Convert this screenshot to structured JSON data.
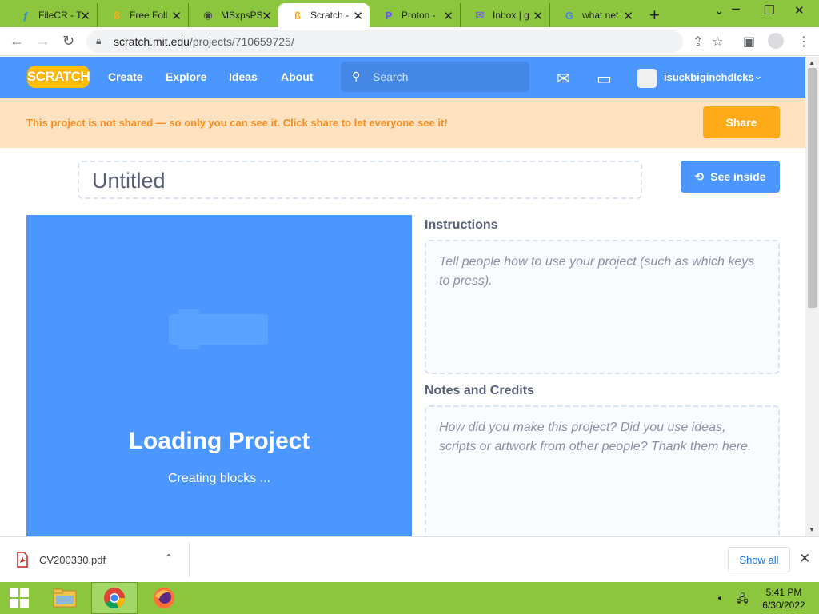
{
  "browser": {
    "tabs": [
      {
        "title": "FileCR - T",
        "icon": "filecr-icon",
        "active": false
      },
      {
        "title": "Free Foll",
        "icon": "scratch-cat-icon",
        "active": false
      },
      {
        "title": "MSxpsPS",
        "icon": "globe-icon",
        "active": false
      },
      {
        "title": "Scratch -",
        "icon": "scratch-cat-icon",
        "active": true
      },
      {
        "title": "Proton -",
        "icon": "proton-icon",
        "active": false
      },
      {
        "title": "Inbox | g",
        "icon": "mail-icon",
        "active": false
      },
      {
        "title": "what net",
        "icon": "google-icon",
        "active": false
      }
    ],
    "address": {
      "host": "scratch.mit.edu",
      "path": "/projects/710659725/"
    }
  },
  "scratch_nav": {
    "logo": "SCRATCH",
    "links": [
      "Create",
      "Explore",
      "Ideas",
      "About"
    ],
    "search_placeholder": "Search",
    "username": "isuckbiginchdlcks"
  },
  "banner": {
    "message": "This project is not shared — so only you can see it. Click share to let everyone see it!",
    "share_label": "Share"
  },
  "project": {
    "title": "Untitled",
    "see_inside_label": "See inside",
    "loading_title": "Loading Project",
    "loading_status": "Creating blocks ..."
  },
  "instructions": {
    "heading": "Instructions",
    "placeholder": "Tell people how to use your project (such as which keys to press)."
  },
  "notes": {
    "heading": "Notes and Credits",
    "placeholder": "How did you make this project? Did you use ideas, scripts or artwork from other people? Thank them here."
  },
  "downloads": {
    "file_name": "CV200330.pdf",
    "show_all_label": "Show all"
  },
  "taskbar": {
    "time": "5:41 PM",
    "date": "6/30/2022"
  },
  "colors": {
    "scratch_blue": "#4c97ff",
    "share_orange": "#ffab19",
    "banner_bg": "#ffe2c2",
    "banner_text": "#ff8c1a",
    "tabstrip_green": "#8cc63f"
  }
}
